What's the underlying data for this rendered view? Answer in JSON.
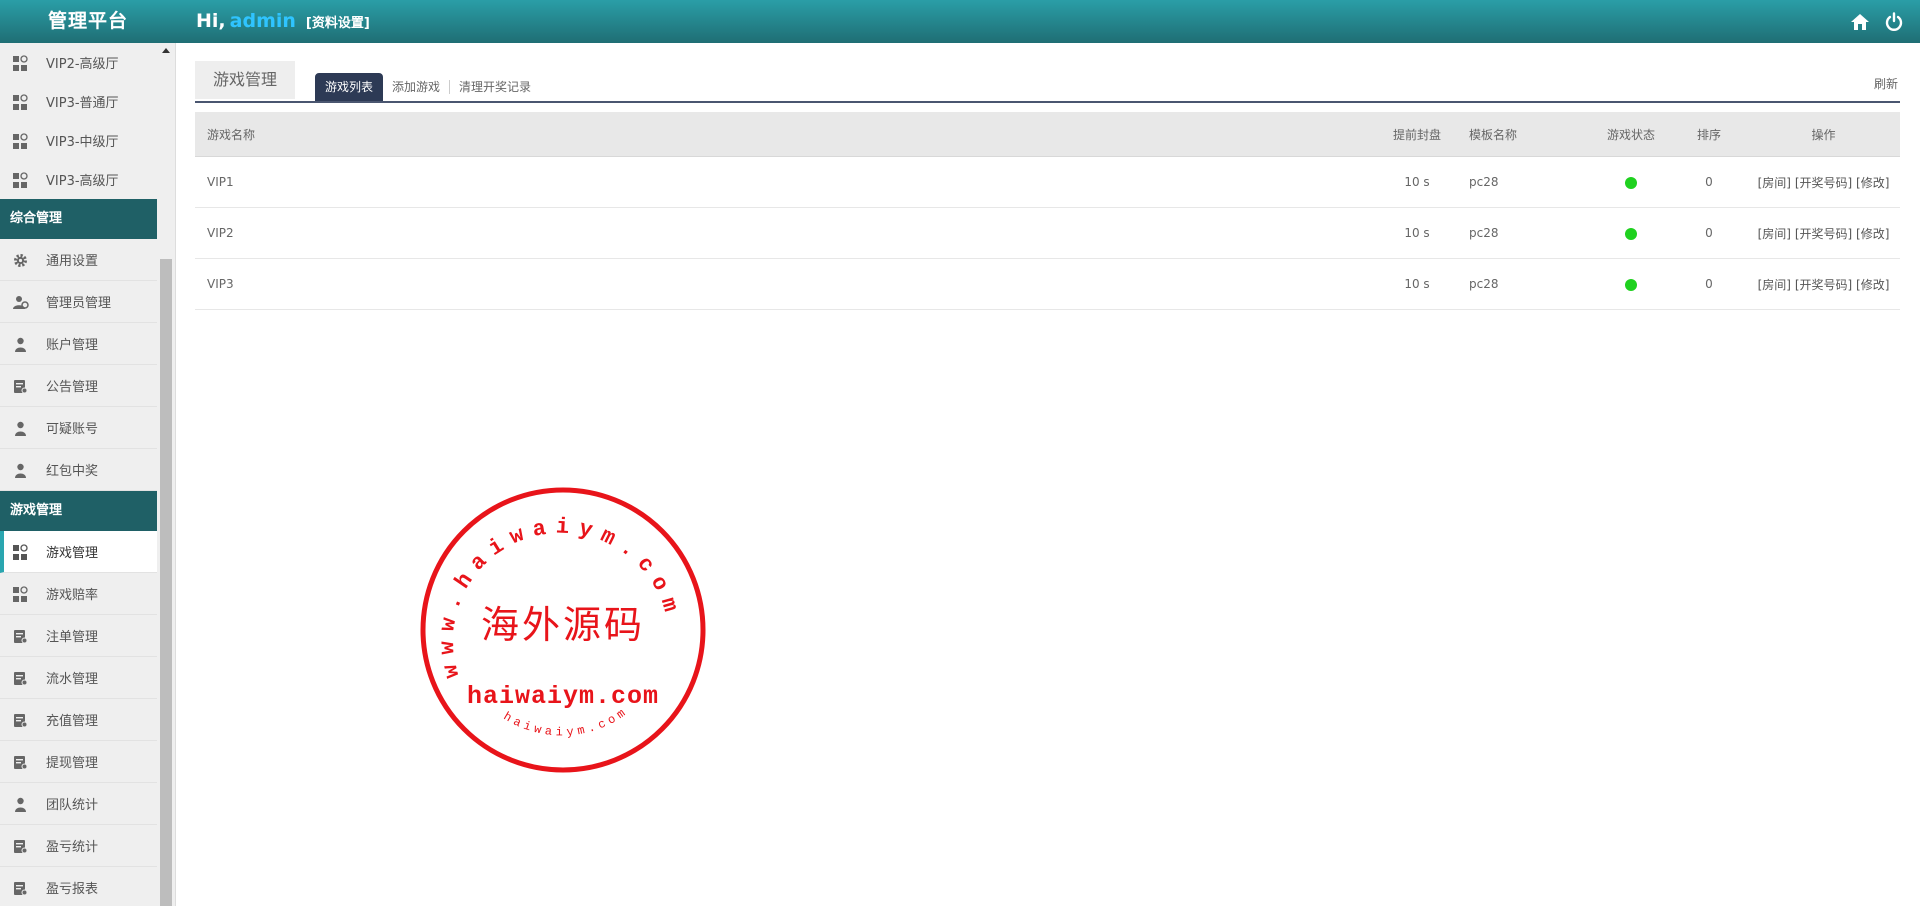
{
  "header": {
    "brand": "管理平台",
    "greeting": "Hi,",
    "username": "admin",
    "profile_link": "[资料设置]",
    "icons": [
      "home-icon",
      "power-icon"
    ]
  },
  "sidebar": {
    "top_items": [
      {
        "label": "VIP2-高级厅",
        "icon": "grid-icon"
      },
      {
        "label": "VIP3-普通厅",
        "icon": "grid-icon"
      },
      {
        "label": "VIP3-中级厅",
        "icon": "grid-icon"
      },
      {
        "label": "VIP3-高级厅",
        "icon": "grid-icon"
      }
    ],
    "section_general": "综合管理",
    "general_items": [
      {
        "label": "通用设置",
        "icon": "gear-icon"
      },
      {
        "label": "管理员管理",
        "icon": "users-icon"
      },
      {
        "label": "账户管理",
        "icon": "user-icon"
      },
      {
        "label": "公告管理",
        "icon": "doc-icon"
      },
      {
        "label": "可疑账号",
        "icon": "user-icon"
      },
      {
        "label": "红包中奖",
        "icon": "user-icon"
      }
    ],
    "section_game": "游戏管理",
    "game_items": [
      {
        "label": "游戏管理",
        "icon": "grid-icon"
      },
      {
        "label": "游戏赔率",
        "icon": "grid-icon"
      },
      {
        "label": "注单管理",
        "icon": "doc-icon"
      },
      {
        "label": "流水管理",
        "icon": "doc-icon"
      },
      {
        "label": "充值管理",
        "icon": "doc-icon"
      },
      {
        "label": "提现管理",
        "icon": "doc-icon"
      },
      {
        "label": "团队统计",
        "icon": "user-icon"
      },
      {
        "label": "盈亏统计",
        "icon": "doc-icon"
      },
      {
        "label": "盈亏报表",
        "icon": "doc-icon"
      }
    ]
  },
  "main": {
    "title": "游戏管理",
    "subtabs": [
      "游戏列表",
      "添加游戏",
      "清理开奖记录"
    ],
    "refresh": "刷新",
    "table": {
      "headers": [
        "游戏名称",
        "提前封盘",
        "模板名称",
        "游戏状态",
        "排序",
        "操作"
      ],
      "rows": [
        {
          "name": "VIP1",
          "advance": "10 s",
          "template": "pc28",
          "status_color": "#1fd11f",
          "sort": "0",
          "ops": [
            "[房间]",
            "[开奖号码]",
            "[修改]"
          ]
        },
        {
          "name": "VIP2",
          "advance": "10 s",
          "template": "pc28",
          "status_color": "#1fd11f",
          "sort": "0",
          "ops": [
            "[房间]",
            "[开奖号码]",
            "[修改]"
          ]
        },
        {
          "name": "VIP3",
          "advance": "10 s",
          "template": "pc28",
          "status_color": "#1fd11f",
          "sort": "0",
          "ops": [
            "[房间]",
            "[开奖号码]",
            "[修改]"
          ]
        }
      ]
    }
  },
  "watermark": {
    "arc_text": "www.haiwaiym.com",
    "center_text": "海外源码",
    "domain_text": "haiwaiym.com",
    "bottom_text": "haiwaiym.com",
    "color": "#e8141a"
  },
  "colors": {
    "topbar": "#2a9ea7",
    "section_header": "#1f6066",
    "active_tab": "#2d3a55",
    "accent": "#2aa6b0",
    "status_on": "#1fd11f"
  }
}
